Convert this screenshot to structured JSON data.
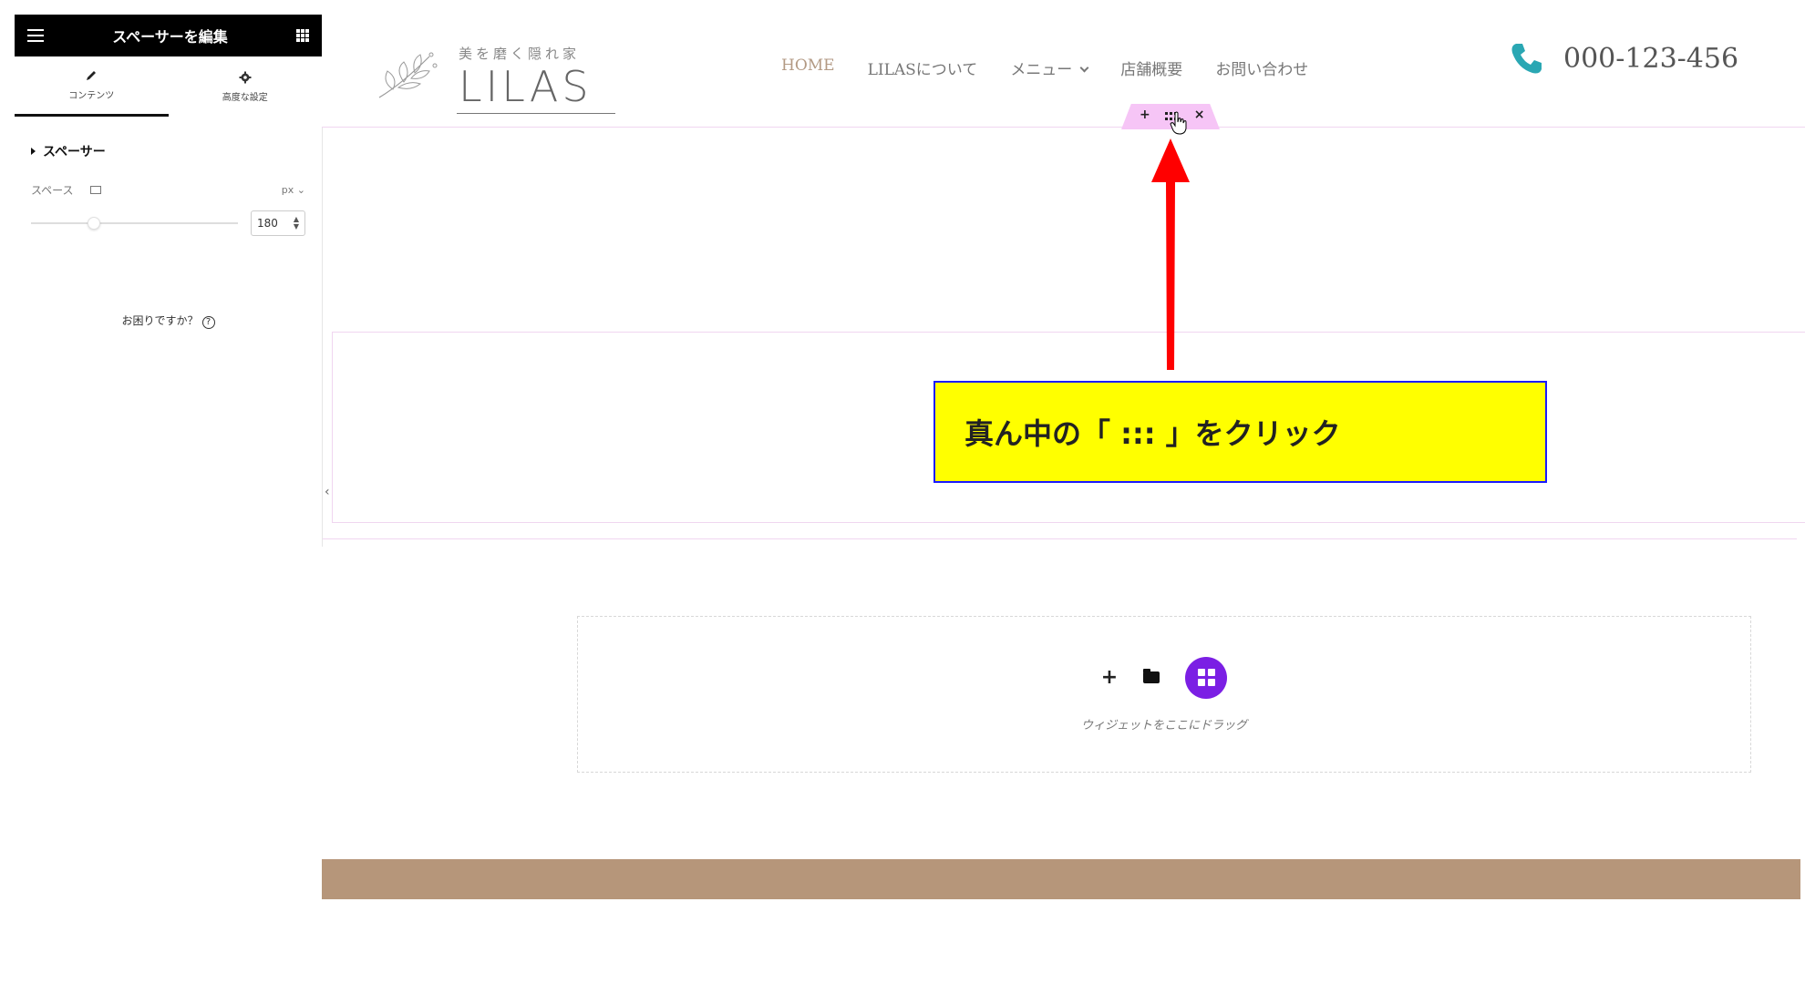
{
  "editor": {
    "title": "スペーサーを編集",
    "tabs": [
      {
        "label": "コンテンツ",
        "icon": "pencil-icon",
        "active": true
      },
      {
        "label": "高度な設定",
        "icon": "gear-icon",
        "active": false
      }
    ],
    "section_title": "スペーサー",
    "space_label": "スペース",
    "unit": "px",
    "space_value": "180",
    "help_text": "お困りですか？"
  },
  "site": {
    "logo_tagline": "美を磨く隠れ家",
    "logo_brand": "LILAS",
    "nav": [
      "HOME",
      "LILASについて",
      "メニュー",
      "店舗概要",
      "お問い合わせ"
    ],
    "phone": "000-123-456",
    "handle": {
      "add": "+",
      "close": "×"
    },
    "dropzone_label": "ウィジェットをここにドラッグ"
  },
  "annotation": {
    "callout_text": "真ん中の「 ::: 」をクリック"
  },
  "colors": {
    "accent_brown": "#b6967a",
    "handle_pink": "#f6c5f6",
    "callout_yellow": "#ffff00",
    "callout_border": "#1a1aff",
    "arrow_red": "#ff0000",
    "kit_purple": "#7b1fe4",
    "phone_teal": "#2aa7b3"
  }
}
